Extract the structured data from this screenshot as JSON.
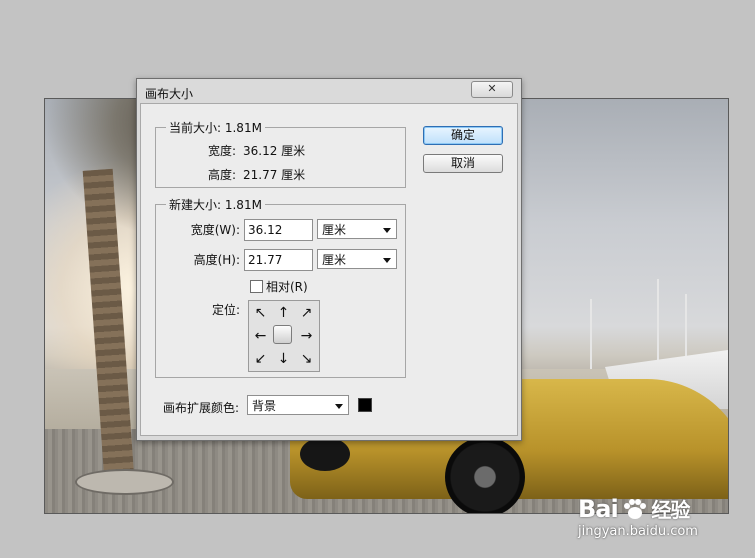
{
  "dialog": {
    "title": "画布大小",
    "close_glyph": "✕",
    "ok_label": "确定",
    "cancel_label": "取消"
  },
  "current_size": {
    "label": "当前大小: 1.81M",
    "width_label": "宽度:",
    "width_value": "36.12 厘米",
    "height_label": "高度:",
    "height_value": "21.77 厘米"
  },
  "new_size": {
    "label": "新建大小: 1.81M",
    "width_label": "宽度(W):",
    "width_value": "36.12",
    "width_unit": "厘米",
    "height_label": "高度(H):",
    "height_value": "21.77",
    "height_unit": "厘米",
    "relative_label": "相对(R)",
    "relative_checked": false,
    "anchor_label": "定位:"
  },
  "extension": {
    "label": "画布扩展颜色:",
    "value": "背景",
    "swatch_color": "#000000"
  },
  "watermark": {
    "brand": "Bai",
    "brand_suffix": "经验",
    "url": "jingyan.baidu.com"
  }
}
